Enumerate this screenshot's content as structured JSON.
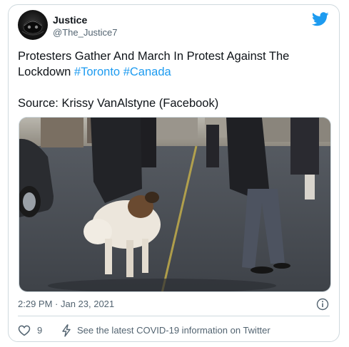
{
  "author": {
    "display_name": "Justice",
    "handle": "@The_Justice7"
  },
  "tweet": {
    "text_line1": "Protesters Gather And March In Protest Against The",
    "text_line2_prefix": "Lockdown ",
    "hashtag1": "#Toronto",
    "hashtag2": "#Canada",
    "source_line": "Source: Krissy VanAlstyne (Facebook)"
  },
  "footer": {
    "timestamp": "2:29 PM · Jan 23, 2021",
    "like_count": "9",
    "covid_link": "See the latest COVID-19 information on Twitter"
  },
  "icons": {
    "brand": "twitter-bird-icon",
    "info": "info-icon",
    "like": "heart-icon",
    "covid": "lightning-bolt-icon"
  },
  "colors": {
    "accent": "#1d9bf0",
    "secondary_text": "#536471",
    "border": "#cfd9de"
  }
}
